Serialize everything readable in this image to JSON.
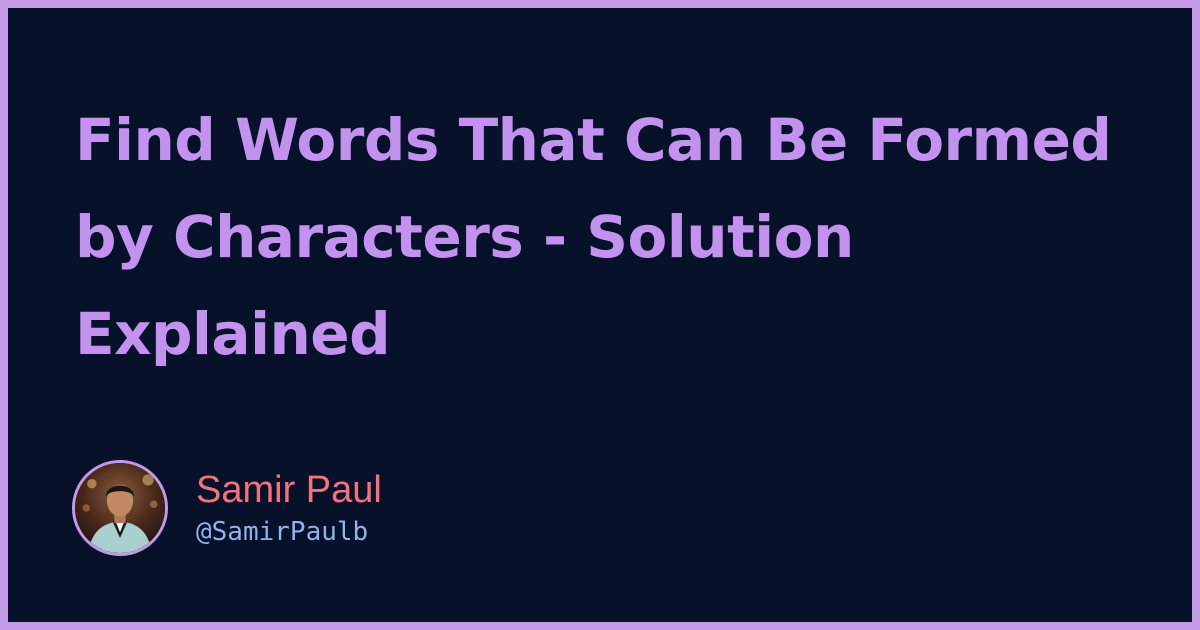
{
  "title": "Find Words That Can Be Formed by Characters - Solution Explained",
  "author": {
    "name": "Samir Paul",
    "handle": "@SamirPaulb",
    "avatar_icon": "profile-photo-icon"
  },
  "colors": {
    "frame": "#c49ae6",
    "background": "#07112a",
    "title": "#c392ee",
    "name": "#f2737c",
    "handle": "#8fb2f0"
  }
}
